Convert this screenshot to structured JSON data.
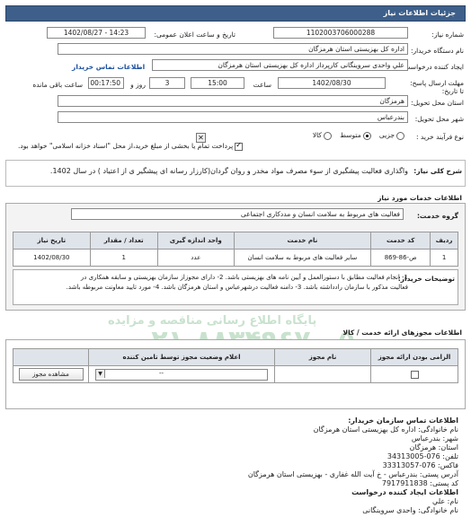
{
  "header": {
    "title": "جزئیات اطلاعات نیاز"
  },
  "form": {
    "need_number_label": "شماره نیاز:",
    "need_number": "1102003706000288",
    "announce_label": "تاریخ و ساعت اعلان عمومی:",
    "announce_value": "1402/08/27 - 14:23",
    "buyer_label": "نام دستگاه خریدار:",
    "buyer_value": "اداره کل بهزیستی استان هرمزگان",
    "requester_label": "ایجاد کننده درخواست:",
    "requester_value": "علي  واحدی سروینگانی کارپرداز اداره کل بهزیستی استان هرمزگان",
    "contact_link": "اطلاعات تماس خریدار",
    "deadline_label": "مهلت ارسال پاسخ: تا تاریخ:",
    "deadline_date": "1402/08/30",
    "time_label": "ساعت",
    "deadline_time": "15:00",
    "days_value": "3",
    "days_label": "روز و",
    "remaining_time": "00:17:50",
    "remaining_label": "ساعت باقی مانده",
    "province_label": "استان محل تحویل:",
    "province_value": "هرمزگان",
    "city_label": "شهر محل تحویل:",
    "city_value": "بندرعباس",
    "purchase_type_label": "نوع فرآیند خرید :",
    "purchase_options": [
      "جزیی",
      "متوسط",
      "کالا"
    ],
    "purchase_selected": "متوسط",
    "payment_note": "پرداخت تمام یا بخشی از مبلغ خرید،از محل \"اسناد خزانه اسلامی\" خواهد بود."
  },
  "summary": {
    "label": "شرح کلی نیاز:",
    "text": "واگذاری فعالیت پیشگیری از سوء مصرف مواد مخدر و روان گردان(کارزار رسانه ای پیشگیر ی از اعتیاد ) در سال 1402."
  },
  "services": {
    "section_title": "اطلاعات خدمات مورد نیاز",
    "group_label": "گروه خدمت:",
    "group_value": "فعالیت های مربوط به سلامت انسان و مددکاری اجتماعی",
    "columns": [
      "ردیف",
      "کد خدمت",
      "نام خدمت",
      "واحد اندازه گیری",
      "تعداد / مقدار",
      "تاریخ نیاز"
    ],
    "rows": [
      [
        "1",
        "ص-86-869",
        "سایر فعالیت های مربوط به سلامت انسان",
        "عدد",
        "1",
        "1402/08/30"
      ]
    ]
  },
  "buyer_notes": {
    "label": "توضیحات خریدار:",
    "line1": "1- انجام فعالیت مطابق با دستورالعمل و آیین نامه های بهزیستی باشد. 2- دارای مجوزاز سازمان بهزیستی و سابقه همکاری در",
    "line2": "فعالیت مذکور با سازمان رادداشته باشد. 3- دامنه فعالیت درشهرعباس و استان هرمزگان باشد. 4- مورد تایید معاونت مربوطه باشد."
  },
  "permits": {
    "section_title": "اطلاعات مجوزهای ارائه خدمت / کالا",
    "columns": [
      "الزامی بودن ارائه مجوز",
      "نام مجوز",
      "اعلام وضعیت مجوز توسط تامین کننده",
      ""
    ],
    "select_value": "--",
    "view_button": "مشاهده مجوز"
  },
  "watermark": {
    "line1": "پایگاه اطلاع رسانی مناقصه و مزایده",
    "line2": "۰۲۱-۸۸۳۴۹۶۷۰-۵"
  },
  "footer": {
    "org_title": "اطلاعات تماس سازمان خریدار:",
    "org_name": "نام خانوادگی: اداره کل بهزیستی استان هرمزگان",
    "city": "شهر: بندرعباس",
    "province": "استان: هرمزگان",
    "phone": "تلفن: 076-34313005",
    "fax": "فاکس: 076-33313057",
    "address": "آدرس پستی: بندرعباس - خ آیت الله غفاری - بهزیستی استان هرمزگان",
    "postal": "کد پستی: 7917911838",
    "creator_title": "اطلاعات ایجاد کننده درخواست",
    "creator_name": "نام: علي",
    "creator_family": "نام خانوادگی: واحدی سروینگانی"
  },
  "colors": {
    "header_bg": "#3d5f8a",
    "watermark": "#2e8c3c"
  }
}
